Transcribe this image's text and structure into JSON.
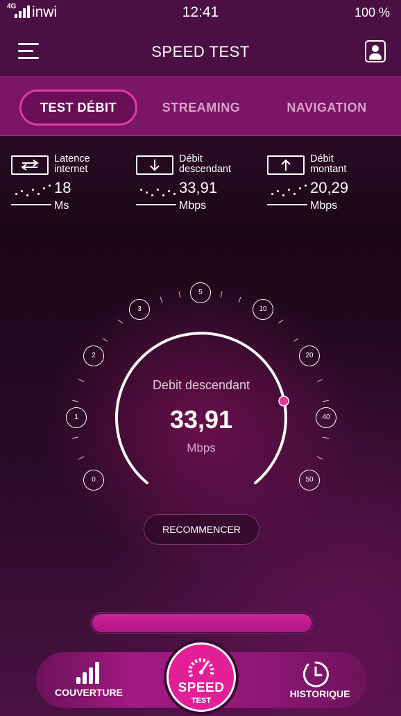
{
  "status_bar": {
    "network": "4G",
    "carrier": "inwi",
    "time": "12:41",
    "battery": "100 %"
  },
  "header": {
    "title": "SPEED TEST",
    "menu_icon": "hamburger-menu-icon",
    "profile_icon": "user-profile-icon"
  },
  "tabs": [
    {
      "label": "TEST DÉBIT",
      "active": true
    },
    {
      "label": "STREAMING",
      "active": false
    },
    {
      "label": "NAVIGATION",
      "active": false
    }
  ],
  "metrics": [
    {
      "label_line1": "Latence",
      "label_line2": "internet",
      "value": "18",
      "unit": "Ms",
      "icon": "bidirectional-arrow-icon"
    },
    {
      "label_line1": "Débit",
      "label_line2": "descendant",
      "value": "33,91",
      "unit": "Mbps",
      "icon": "download-arrow-icon"
    },
    {
      "label_line1": "Débit",
      "label_line2": "montant",
      "value": "20,29",
      "unit": "Mbps",
      "icon": "upload-arrow-icon"
    }
  ],
  "gauge": {
    "label": "Debit descendant",
    "value": "33,91",
    "unit": "Mbps",
    "scale": [
      "0",
      "1",
      "2",
      "3",
      "5",
      "10",
      "20",
      "40",
      "50"
    ],
    "accent": "#e6348f"
  },
  "restart_label": "RECOMMENCER",
  "progress_fraction": 1.0,
  "bottom_nav": {
    "left_label": "COUVERTURE",
    "center_label_1": "SPEED",
    "center_label_2": "TEST",
    "right_label": "HISTORIQUE"
  },
  "colors": {
    "brand_pink": "#e31f97",
    "tab_bar": "#7b1566",
    "header": "#4a1044"
  }
}
